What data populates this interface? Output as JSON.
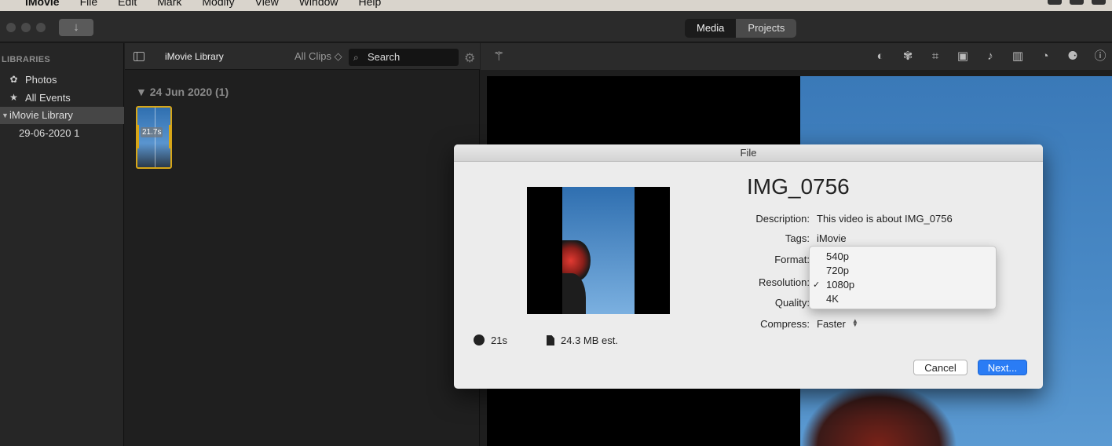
{
  "menubar": {
    "app_name": "iMovie",
    "items": [
      "File",
      "Edit",
      "Mark",
      "Modify",
      "View",
      "Window",
      "Help"
    ]
  },
  "toolbar": {
    "import_icon": "↓",
    "tabs": [
      {
        "label": "Media",
        "active": false
      },
      {
        "label": "Projects",
        "active": true
      }
    ]
  },
  "sidebar": {
    "heading": "LIBRARIES",
    "items": [
      {
        "label": "Photos",
        "icon": "photos-icon"
      },
      {
        "label": "All Events",
        "icon": "star-icon"
      },
      {
        "label": "iMovie Library",
        "selected": true
      },
      {
        "label": "29-06-2020 1"
      }
    ]
  },
  "browser": {
    "title": "iMovie Library",
    "filter": "All Clips ◇",
    "search_label": "Search",
    "date_heading": "▼  24 Jun 2020   (1)",
    "clip_duration": "21.7s"
  },
  "dialog": {
    "title": "File",
    "name": "IMG_0756",
    "fields": {
      "description_label": "Description:",
      "description_value": "This video is about IMG_0756",
      "tags_label": "Tags:",
      "tags_value": "iMovie",
      "format_label": "Format:",
      "resolution_label": "Resolution:",
      "quality_label": "Quality:",
      "compress_label": "Compress:",
      "compress_value": "Faster"
    },
    "duration": "21s",
    "size": "24.3 MB est.",
    "cancel_label": "Cancel",
    "next_label": "Next..."
  },
  "resolution_menu": {
    "options": [
      "540p",
      "720p",
      "1080p",
      "4K"
    ],
    "selected": "1080p",
    "checkmark": "✓"
  },
  "colors": {
    "accent": "#2a7cf5",
    "clip_border": "#d7a618"
  }
}
